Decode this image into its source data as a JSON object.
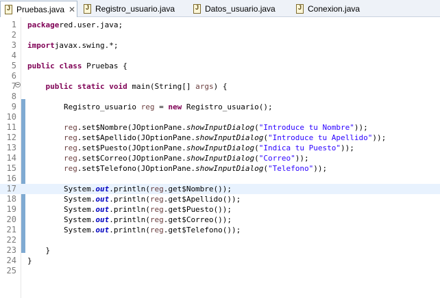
{
  "tabs": [
    {
      "name": "Pruebas.java",
      "active": true,
      "close": "✕"
    },
    {
      "name": "Registro_usuario.java",
      "active": false
    },
    {
      "name": "Datos_usuario.java",
      "active": false
    },
    {
      "name": "Conexion.java",
      "active": false
    }
  ],
  "editor": {
    "current_line": 17,
    "lines": [
      {
        "n": "1",
        "t": [
          [
            "kw",
            "package"
          ],
          [
            "",
            "red.user.java;"
          ]
        ]
      },
      {
        "n": "2",
        "t": []
      },
      {
        "n": "3",
        "t": [
          [
            "kw",
            "import"
          ],
          [
            "",
            "javax.swing.*;"
          ]
        ]
      },
      {
        "n": "4",
        "t": []
      },
      {
        "n": "5",
        "t": [
          [
            "kw",
            "public"
          ],
          [
            "",
            " "
          ],
          [
            "kw",
            "class"
          ],
          [
            "",
            " Pruebas {"
          ]
        ]
      },
      {
        "n": "6",
        "t": []
      },
      {
        "n": "7",
        "t": [
          [
            "",
            "    "
          ],
          [
            "kw",
            "public"
          ],
          [
            "",
            " "
          ],
          [
            "kw",
            "static"
          ],
          [
            "",
            " "
          ],
          [
            "kw",
            "void"
          ],
          [
            "",
            " main(String[] "
          ],
          [
            "var",
            "args"
          ],
          [
            "",
            ") {"
          ]
        ]
      },
      {
        "n": "8",
        "t": []
      },
      {
        "n": "9",
        "t": [
          [
            "",
            "        Registro_usuario "
          ],
          [
            "var",
            "reg"
          ],
          [
            "",
            " = "
          ],
          [
            "kw",
            "new"
          ],
          [
            "",
            " Registro_usuario();"
          ]
        ]
      },
      {
        "n": "10",
        "t": []
      },
      {
        "n": "11",
        "t": [
          [
            "",
            "        "
          ],
          [
            "var",
            "reg"
          ],
          [
            "",
            ".set$Nombre(JOptionPane."
          ],
          [
            "mth",
            "showInputDialog"
          ],
          [
            "",
            "("
          ],
          [
            "str",
            "\"Introduce tu Nombre\""
          ],
          [
            "",
            "));"
          ]
        ]
      },
      {
        "n": "12",
        "t": [
          [
            "",
            "        "
          ],
          [
            "var",
            "reg"
          ],
          [
            "",
            ".set$Apellido(JOptionPane."
          ],
          [
            "mth",
            "showInputDialog"
          ],
          [
            "",
            "("
          ],
          [
            "str",
            "\"Introduce tu Apellido\""
          ],
          [
            "",
            "));"
          ]
        ]
      },
      {
        "n": "13",
        "t": [
          [
            "",
            "        "
          ],
          [
            "var",
            "reg"
          ],
          [
            "",
            ".set$Puesto(JOptionPane."
          ],
          [
            "mth",
            "showInputDialog"
          ],
          [
            "",
            "("
          ],
          [
            "str",
            "\"Indica tu Puesto\""
          ],
          [
            "",
            "));"
          ]
        ]
      },
      {
        "n": "14",
        "t": [
          [
            "",
            "        "
          ],
          [
            "var",
            "reg"
          ],
          [
            "",
            ".set$Correo(JOptionPane."
          ],
          [
            "mth",
            "showInputDialog"
          ],
          [
            "",
            "("
          ],
          [
            "str",
            "\"Correo\""
          ],
          [
            "",
            "));"
          ]
        ]
      },
      {
        "n": "15",
        "t": [
          [
            "",
            "        "
          ],
          [
            "var",
            "reg"
          ],
          [
            "",
            ".set$Telefono(JOptionPane."
          ],
          [
            "mth",
            "showInputDialog"
          ],
          [
            "",
            "("
          ],
          [
            "str",
            "\"Telefono\""
          ],
          [
            "",
            "));"
          ]
        ]
      },
      {
        "n": "16",
        "t": []
      },
      {
        "n": "17",
        "t": [
          [
            "",
            "        System."
          ],
          [
            "fld",
            "out"
          ],
          [
            "",
            ".println("
          ],
          [
            "var",
            "reg"
          ],
          [
            "",
            ".get$Nombre());"
          ]
        ]
      },
      {
        "n": "18",
        "t": [
          [
            "",
            "        System."
          ],
          [
            "fld",
            "out"
          ],
          [
            "",
            ".println("
          ],
          [
            "var",
            "reg"
          ],
          [
            "",
            ".get$Apellido());"
          ]
        ]
      },
      {
        "n": "19",
        "t": [
          [
            "",
            "        System."
          ],
          [
            "fld",
            "out"
          ],
          [
            "",
            ".println("
          ],
          [
            "var",
            "reg"
          ],
          [
            "",
            ".get$Puesto());"
          ]
        ]
      },
      {
        "n": "20",
        "t": [
          [
            "",
            "        System."
          ],
          [
            "fld",
            "out"
          ],
          [
            "",
            ".println("
          ],
          [
            "var",
            "reg"
          ],
          [
            "",
            ".get$Correo());"
          ]
        ]
      },
      {
        "n": "21",
        "t": [
          [
            "",
            "        System."
          ],
          [
            "fld",
            "out"
          ],
          [
            "",
            ".println("
          ],
          [
            "var",
            "reg"
          ],
          [
            "",
            ".get$Telefono());"
          ]
        ]
      },
      {
        "n": "22",
        "t": []
      },
      {
        "n": "23",
        "t": [
          [
            "",
            "    }"
          ]
        ]
      },
      {
        "n": "24",
        "t": [
          [
            "",
            "}"
          ]
        ]
      },
      {
        "n": "25",
        "t": []
      }
    ]
  }
}
